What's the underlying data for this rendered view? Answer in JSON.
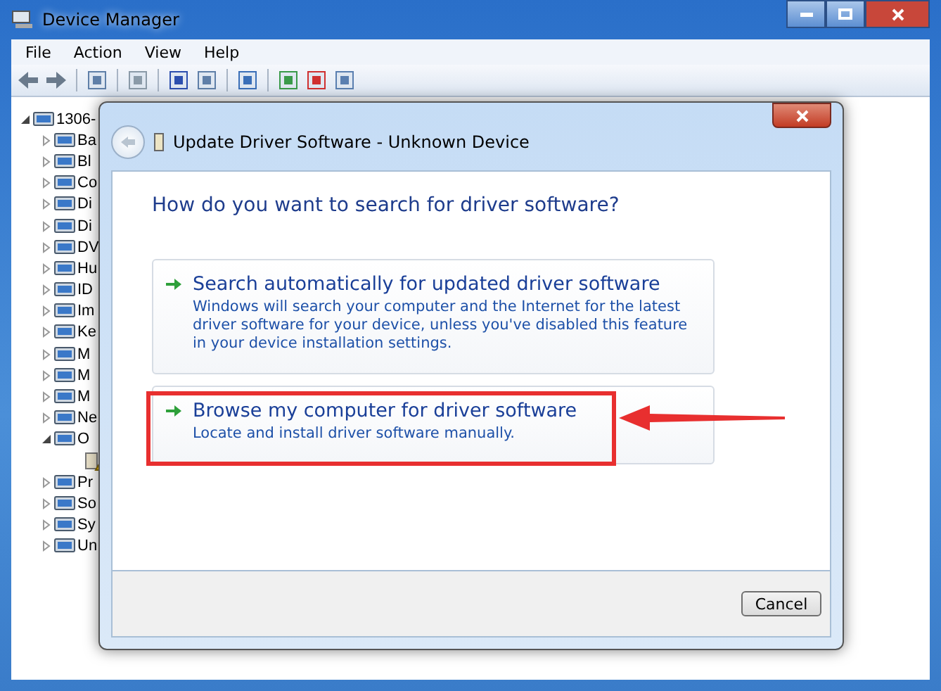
{
  "window": {
    "title": "Device Manager"
  },
  "menu": [
    "File",
    "Action",
    "View",
    "Help"
  ],
  "toolbar": [
    {
      "kind": "back"
    },
    {
      "kind": "forward"
    },
    {
      "kind": "sep"
    },
    {
      "kind": "tree"
    },
    {
      "kind": "sep"
    },
    {
      "kind": "props"
    },
    {
      "kind": "sep"
    },
    {
      "kind": "help"
    },
    {
      "kind": "panel"
    },
    {
      "kind": "sep"
    },
    {
      "kind": "scan"
    },
    {
      "kind": "sep"
    },
    {
      "kind": "update"
    },
    {
      "kind": "uninstall"
    },
    {
      "kind": "disable"
    }
  ],
  "tree": {
    "label": "1306-",
    "expanded": true,
    "children": [
      {
        "label": "Ba",
        "expanded": false
      },
      {
        "label": "Bl",
        "expanded": false
      },
      {
        "label": "Co",
        "expanded": false
      },
      {
        "label": "Di",
        "expanded": false
      },
      {
        "label": "Di",
        "expanded": false
      },
      {
        "label": "DV",
        "expanded": false
      },
      {
        "label": "Hu",
        "expanded": false
      },
      {
        "label": "ID",
        "expanded": false
      },
      {
        "label": "Im",
        "expanded": false
      },
      {
        "label": "Ke",
        "expanded": false
      },
      {
        "label": "M",
        "expanded": false
      },
      {
        "label": "M",
        "expanded": false
      },
      {
        "label": "M",
        "expanded": false
      },
      {
        "label": "Ne",
        "expanded": false
      },
      {
        "label": "O",
        "expanded": true,
        "children": [
          {
            "kind": "warning-device"
          }
        ]
      },
      {
        "label": "Pr",
        "expanded": false
      },
      {
        "label": "So",
        "expanded": false
      },
      {
        "label": "Sy",
        "expanded": false
      },
      {
        "label": "Un",
        "expanded": false
      }
    ]
  },
  "dialog": {
    "title": "Update Driver Software - Unknown Device",
    "question": "How do you want to search for driver software?",
    "options": [
      {
        "title": "Search automatically for updated driver software",
        "description": "Windows will search your computer and the Internet for the latest driver software for your device, unless you've disabled this feature in your device installation settings.",
        "highlighted": false
      },
      {
        "title": "Browse my computer for driver software",
        "description": "Locate and install driver software manually.",
        "highlighted": true
      }
    ],
    "buttons": [
      "Cancel"
    ]
  }
}
